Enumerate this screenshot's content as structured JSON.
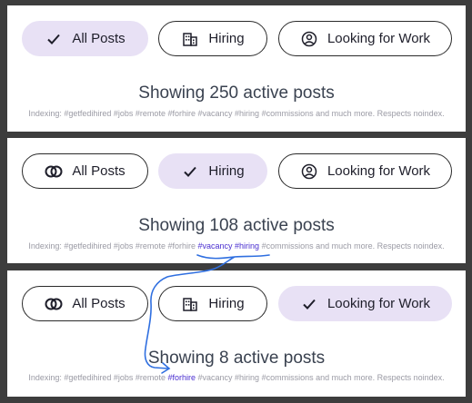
{
  "panels": [
    {
      "buttons": {
        "all": "All Posts",
        "hiring": "Hiring",
        "work": "Looking for Work"
      },
      "selected": "all",
      "showing": "Showing 250 active posts",
      "indexing": {
        "prefix": "Indexing: #getfedihired #jobs #remote ",
        "forhire": "#forhire",
        "sp1": " ",
        "vacancy": "#vacancy",
        "sp2": " ",
        "hiring": "#hiring",
        "suffix": " #commissions and much more. Respects noindex."
      }
    },
    {
      "buttons": {
        "all": "All Posts",
        "hiring": "Hiring",
        "work": "Looking for Work"
      },
      "selected": "hiring",
      "showing": "Showing 108 active posts",
      "indexing": {
        "prefix": "Indexing: #getfedihired #jobs #remote ",
        "forhire": "#forhire",
        "sp1": " ",
        "vacancy": "#vacancy",
        "sp2": " ",
        "hiring": "#hiring",
        "suffix": " #commissions and much more. Respects noindex."
      }
    },
    {
      "buttons": {
        "all": "All Posts",
        "hiring": "Hiring",
        "work": "Looking for Work"
      },
      "selected": "work",
      "showing": "Showing 8 active posts",
      "indexing": {
        "prefix": "Indexing: #getfedihired #jobs #remote ",
        "forhire": "#forhire",
        "sp1": " ",
        "vacancy": "#vacancy",
        "sp2": " ",
        "hiring": "#hiring",
        "suffix": " #commissions and much more. Respects noindex."
      }
    }
  ],
  "icons": {
    "selected": "check-icon",
    "all": "overlapping-circles-icon",
    "hiring": "building-icon",
    "work": "person-circle-icon"
  },
  "colors": {
    "selected_bg": "#e8e1f5",
    "highlight_tag": "#4a2fd0",
    "annotation": "#2f6fe0"
  }
}
